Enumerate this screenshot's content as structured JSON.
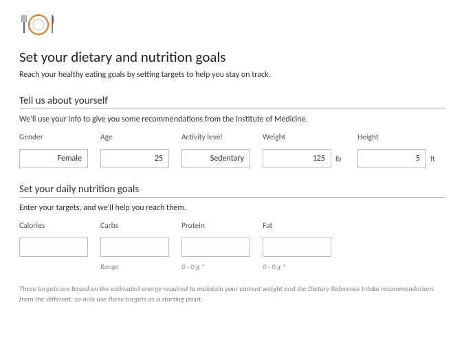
{
  "header": {
    "title": "Set your dietary and nutrition goals",
    "lead": "Reach your healthy eating goals by setting targets to help you stay on track."
  },
  "section_about": {
    "title": "Tell us about yourself",
    "sub": "We'll use your info to give you some recommendations from the Institute of Medicine.",
    "fields": {
      "gender": {
        "label": "Gender",
        "value": "Female"
      },
      "age": {
        "label": "Age",
        "value": "25"
      },
      "activity": {
        "label": "Activity level",
        "value": "Sedentary"
      },
      "weight": {
        "label": "Weight",
        "value": "125",
        "unit": "lb"
      },
      "height": {
        "label": "Height",
        "value": "5",
        "unit": "ft"
      }
    }
  },
  "section_goals": {
    "title": "Set your daily nutrition goals",
    "sub": "Enter your targets, and we'll help you reach them.",
    "fields": {
      "calories": {
        "label": "Calories",
        "value": "",
        "hint": ""
      },
      "carbs": {
        "label": "Carbs",
        "value": "",
        "hint": "Range"
      },
      "protein": {
        "label": "Protein",
        "value": "",
        "hint": "0 - 0 g *"
      },
      "fat": {
        "label": "Fat",
        "value": "",
        "hint": "0 - 0 g *"
      }
    }
  },
  "footnote": "These targets are based on the estimated energy required to maintain your current weight and the Dietary Reference Intake recommendations from the different, so only use these targets as a starting point."
}
